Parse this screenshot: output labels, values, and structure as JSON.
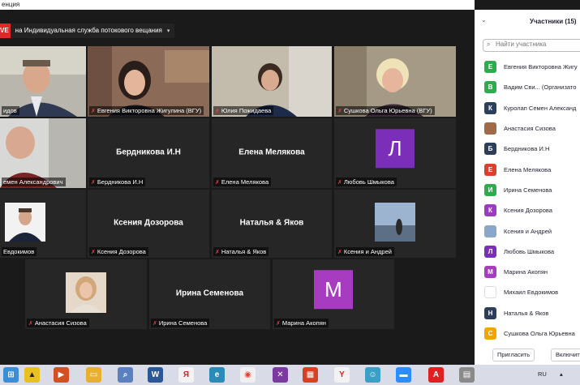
{
  "window": {
    "title_fragment": "енция"
  },
  "live_banner": {
    "badge": "VE",
    "text": "на Индивидуальная служба потокового вещания",
    "arrow": "▾"
  },
  "tiles": [
    {
      "name": "идов",
      "big": "",
      "muted": false,
      "active": true
    },
    {
      "name": "Евгения Викторовна Жигулина (ВГУ)",
      "big": "",
      "muted": true
    },
    {
      "name": "Юлия Пожидаева",
      "big": "",
      "muted": true
    },
    {
      "name": "Сушкова Ольга Юрьевна (ВГУ)",
      "big": "",
      "muted": true
    },
    {
      "name": "емен Александрович",
      "big": "",
      "muted": false
    },
    {
      "name": "Бердникова И.Н",
      "big": "Бердникова И.Н",
      "muted": true
    },
    {
      "name": "Елена Мелякова",
      "big": "Елена Мелякова",
      "muted": true
    },
    {
      "name": "Любовь Шмыкова",
      "big": "",
      "avatar": "Л",
      "avatar_color": "#7b2fb8",
      "muted": true
    },
    {
      "name": "Евдокимов",
      "big": "",
      "muted": false
    },
    {
      "name": "Ксения Дозорова",
      "big": "Ксения Дозорова",
      "muted": true
    },
    {
      "name": "Наталья & Яков",
      "big": "Наталья & Яков",
      "muted": true
    },
    {
      "name": "Ксения и Андрей",
      "big": "",
      "muted": true
    },
    {
      "name": "Анастасия Сизова",
      "big": "",
      "muted": true
    },
    {
      "name": "Ирина Семенова",
      "big": "Ирина Семенова",
      "muted": true
    },
    {
      "name": "Марина Акопян",
      "big": "",
      "avatar": "М",
      "avatar_color": "#a83cc0",
      "muted": true
    }
  ],
  "sidebar": {
    "title": "Участники (15)",
    "search_placeholder": "Найти участника",
    "participants": [
      {
        "letter": "Е",
        "color": "#2eaa4f",
        "name": "Евгения Викторовна Жигу"
      },
      {
        "letter": "В",
        "color": "#2eaa4f",
        "name": "Вадим Сви... (Организато"
      },
      {
        "letter": "К",
        "color": "#2d3e58",
        "name": "Куролап Семен Александ"
      },
      {
        "letter": "",
        "color": "#a06a4a",
        "name": "Анастасия Сизова"
      },
      {
        "letter": "Б",
        "color": "#2d3e58",
        "name": "Бердникова И.Н"
      },
      {
        "letter": "Е",
        "color": "#d9412b",
        "name": "Елена Мелякова"
      },
      {
        "letter": "И",
        "color": "#2eaa4f",
        "name": "Ирина Семенова"
      },
      {
        "letter": "К",
        "color": "#9a3cc0",
        "name": "Ксения Дозорова"
      },
      {
        "letter": "",
        "color": "#8aa6c8",
        "name": "Ксения и Андрей"
      },
      {
        "letter": "Л",
        "color": "#7b2fb8",
        "name": "Любовь Шмыкова"
      },
      {
        "letter": "М",
        "color": "#a83cc0",
        "name": "Марина Акопян"
      },
      {
        "letter": "",
        "color": "#ffffff",
        "name": "Михаил Евдокимов"
      },
      {
        "letter": "Н",
        "color": "#2d3e58",
        "name": "Наталья & Яков"
      },
      {
        "letter": "С",
        "color": "#f0a500",
        "name": "Сушкова Ольга Юрьевна"
      }
    ],
    "invite_label": "Пригласить",
    "mute_label": "Включит"
  },
  "taskbar": {
    "lang": "RU"
  }
}
